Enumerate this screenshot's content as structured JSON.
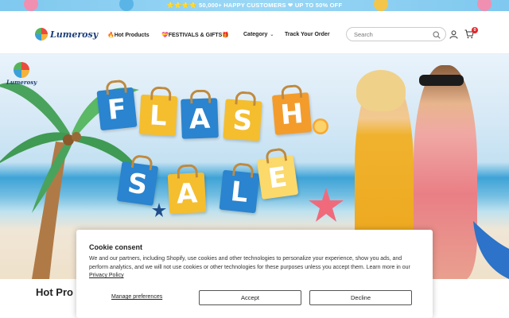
{
  "announcement": {
    "text": "⭐⭐⭐⭐ 50,000+ HAPPY CUSTOMERS ❤ UP TO 50% OFF"
  },
  "header": {
    "brand": "Lumerosy",
    "nav": [
      {
        "label": "🔥Hot Products"
      },
      {
        "label": "💝FESTIVALS & GIFTS🎁"
      },
      {
        "label": "Category"
      },
      {
        "label": "Track Your Order"
      }
    ],
    "search": {
      "placeholder": "Search"
    },
    "cart_count": "0"
  },
  "hero": {
    "brand": "Lumerosy",
    "flash_letters": [
      "F",
      "L",
      "A",
      "S",
      "H"
    ],
    "sale_letters": [
      "S",
      "A",
      "L",
      "E"
    ]
  },
  "section": {
    "title": "Hot Pro"
  },
  "cookie": {
    "title": "Cookie consent",
    "body": "We and our partners, including Shopify, use cookies and other technologies to personalize your experience, show you ads, and perform analytics, and we will not use cookies or other technologies for these purposes unless you accept them. Learn more in our",
    "link": "Privacy Policy",
    "manage": "Manage preferences",
    "accept": "Accept",
    "decline": "Decline"
  },
  "colors": {
    "accent_blue": "#2a84cf",
    "accent_yellow": "#f4be2f",
    "badge_red": "#e0262b",
    "sky": "#7fc8ef"
  }
}
